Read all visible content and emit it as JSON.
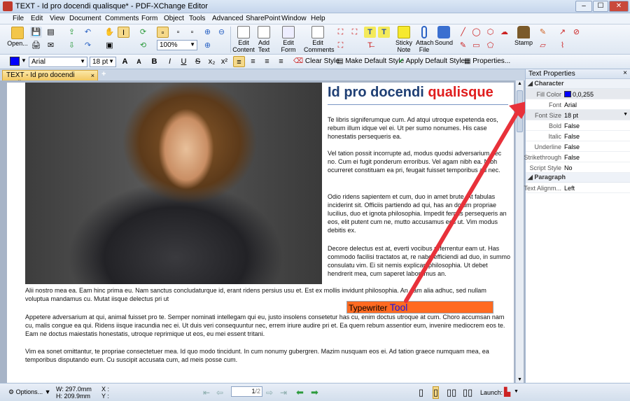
{
  "window": {
    "title": "TEXT - Id pro docendi qualisque* - PDF-XChange Editor",
    "controls": [
      "–",
      "☐",
      "✕"
    ]
  },
  "menu": [
    "File",
    "Edit",
    "View",
    "Document",
    "Comments",
    "Form",
    "Object",
    "Tools",
    "Advanced",
    "SharePoint",
    "Window",
    "Help"
  ],
  "toolbar": {
    "open_label": "Open...",
    "zoom_value": "100%",
    "edit_content": [
      "Edit",
      "Content"
    ],
    "add_text": [
      "Add",
      "Text"
    ],
    "edit_form": [
      "Edit",
      "Form"
    ],
    "edit_comments": [
      "Edit",
      "Comments"
    ],
    "sticky_note": [
      "Sticky",
      "Note"
    ],
    "attach_file": [
      "Attach",
      "File"
    ],
    "sound": "Sound",
    "stamp": "Stamp"
  },
  "format_bar": {
    "font": "Arial",
    "size": "18 pt",
    "clear_style": "Clear Style",
    "make_default_style": "Make Default Style",
    "apply_default_style": "Apply Default Style",
    "properties": "Properties..."
  },
  "tab": {
    "label": "TEXT - Id pro docendi qualisque *",
    "add": "+"
  },
  "doc": {
    "title_part1": "Id pro docendi ",
    "title_part2": "qualisque",
    "p1": "Te libris signiferumque cum. Ad atqui utroque expetenda eos, rebum illum idque vel ei. Ut per sumo nonumes. His case honestatis persequeris ea.",
    "p2": "Vel tation possit incorrupte ad, modus quodsi adversarium nec no. Cum ei fugit ponderum erroribus. Vel agam nibh ea. Nibh ocurreret constituam ea pri, feugait fuisset temporibus ad nec.",
    "p3": "Odio ridens sapientem et cum, duo in amet brute. At fabulas inciderint sit. Officiis partiendo ad qui, has an dolum propriae lucilius, duo et ignota philosophia. Impedit fermis persequeris an eos, elit putent cum ne, mutto accusamus eos ut. Vim modus debitis ex.",
    "p4": "Decore delectus est at, everti vocibus referrentur eam ut. Has commodo facilisi tractatos at, re nabo efficiendi ad duo, in summo consulatu vim. Ei sit nemis explicari philosophia. Ut debet hendrerit mea, cum saperet laboramus an.",
    "p5": "Alii nostro mea ea. Eam hinc prima eu. Nam sanctus concludaturque id, erant ridens persius usu et. Est ex mollis invidunt philosophia. An eam alia adhuc, sed nullam voluptua mandamus cu. Mutat iisque delectus pri ut",
    "p6": "Appetere adversarium at qui, animal fuisset pro te. Semper nominati intellegam qui eu, justo insolens consetetur has cu, enim doctus utroque at cum. Choro accumsan nam cu, malis congue ea qui. Ridens iisque iracundia nec ei. Ut duis veri consequuntur nec, errem iriure audire pri et. Ea quem rebum assentior eum, invenire mediocrem eos te. Eam ne doctus maiestatis honestatis, utroque reprimique ut eos, eu mei essent tritani.",
    "p7": "Vim ea sonet omittantur, te propriae consectetuer mea. Id quo modo tincidunt. In cum nonumy gubergren. Mazim nusquam eos ei. Ad tation graece numquam mea, ea temporibus disputando eum. Cu suscipit accusata cum, ad meis posse cum.",
    "typewriter_text": "Typewriter ",
    "typewriter_tool": "Tool"
  },
  "panel": {
    "title": "Text Properties",
    "close": "×",
    "section_character": "Character",
    "section_paragraph": "Paragraph",
    "rows": [
      {
        "name": "Fill Color",
        "value": "0,0,255"
      },
      {
        "name": "Font",
        "value": "Arial"
      },
      {
        "name": "Font Size",
        "value": "18 pt"
      },
      {
        "name": "Bold",
        "value": "False"
      },
      {
        "name": "Italic",
        "value": "False"
      },
      {
        "name": "Underline",
        "value": "False"
      },
      {
        "name": "Strikethrough",
        "value": "False"
      },
      {
        "name": "Script Style",
        "value": "No"
      }
    ],
    "para_rows": [
      {
        "name": "Text Alignm...",
        "value": "Left"
      }
    ]
  },
  "status": {
    "options": "Options...",
    "width": "W: 297.0mm",
    "height": "H: 209.9mm",
    "x": "X :",
    "y": "Y :",
    "page": "1",
    "page_total": "/2",
    "launch": "Launch:"
  },
  "colors": {
    "accent_arrow": "#e8313a",
    "fill_color": "#0000ff",
    "typewriter_bg": "#ff6a21"
  }
}
